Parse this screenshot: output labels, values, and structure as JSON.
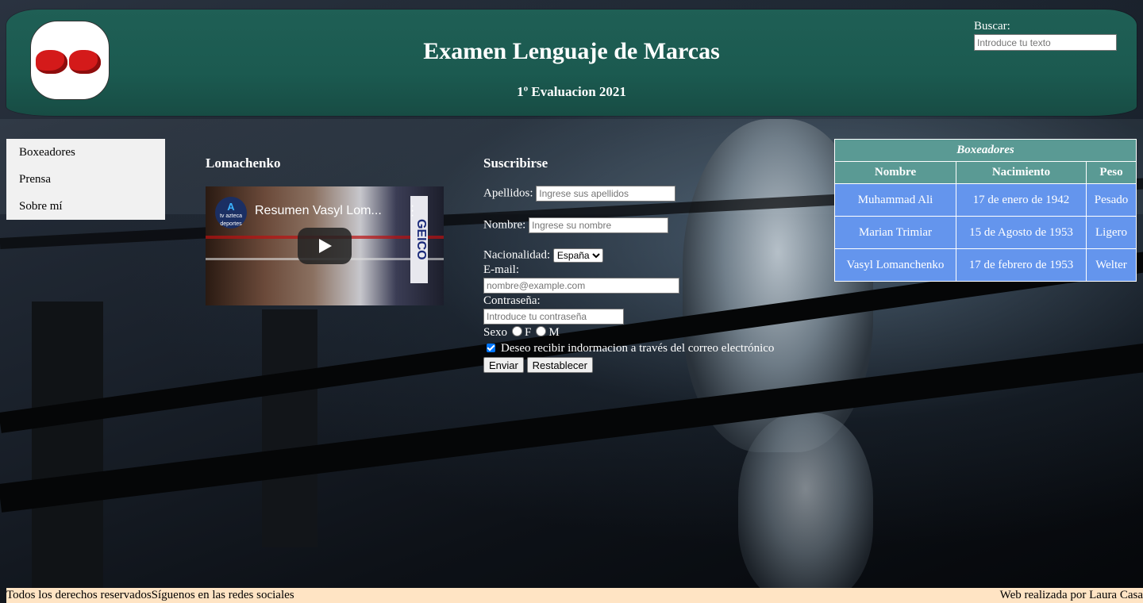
{
  "header": {
    "title": "Examen Lenguaje de Marcas",
    "subtitle": "1º Evaluacion 2021",
    "search_label": "Buscar:",
    "search_placeholder": "Introduce tu texto"
  },
  "sidebar": {
    "items": [
      {
        "label": "Boxeadores"
      },
      {
        "label": "Prensa"
      },
      {
        "label": "Sobre mí"
      }
    ]
  },
  "video_section": {
    "title": "Lomachenko",
    "video_title": "Resumen Vasyl Lom...",
    "channel_name": "tv azteca deportes",
    "sponsor": "GEICO"
  },
  "form": {
    "title": "Suscribirse",
    "apellidos_label": "Apellidos:",
    "apellidos_placeholder": "Ingrese sus apellidos",
    "nombre_label": "Nombre:",
    "nombre_placeholder": "Ingrese su nombre",
    "nacionalidad_label": "Nacionalidad:",
    "nacionalidad_value": "España",
    "email_label": "E-mail:",
    "email_placeholder": "nombre@example.com",
    "password_label": "Contraseña:",
    "password_placeholder": "Introduce tu contraseña",
    "sexo_label": "Sexo",
    "sexo_options": [
      "F",
      "M"
    ],
    "newsletter_label": "Deseo recibir indormacion a través del correo electrónico",
    "newsletter_checked": true,
    "submit_label": "Enviar",
    "reset_label": "Restablecer"
  },
  "table": {
    "caption": "Boxeadores",
    "headers": [
      "Nombre",
      "Nacimiento",
      "Peso"
    ],
    "rows": [
      [
        "Muhammad Ali",
        "17 de enero de 1942",
        "Pesado"
      ],
      [
        "Marian Trimiar",
        "15 de Agosto de 1953",
        "Ligero"
      ],
      [
        "Vasyl Lomanchenko",
        "17 de febrero de 1953",
        "Welter"
      ]
    ]
  },
  "footer": {
    "rights": "Todos los derechos reservados",
    "social": "Síguenos en las redes sociales",
    "credit": "Web realizada por Laura Casa"
  },
  "colors": {
    "header_bg": "#1f5f55",
    "table_header_bg": "#5a9a94",
    "table_cell_bg": "#6495ed",
    "footer_bg": "#ffe4c4",
    "sidebar_bg": "#f1f1f1"
  }
}
